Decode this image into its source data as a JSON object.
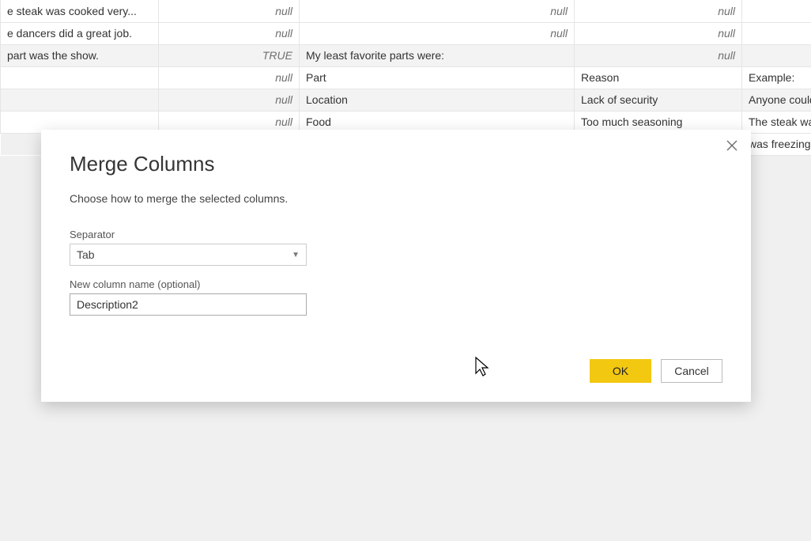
{
  "grid": {
    "rows": [
      {
        "alt": false,
        "c0": "e steak was cooked very...",
        "c1": "null",
        "c2": "null",
        "c3": "null",
        "c4": "null"
      },
      {
        "alt": false,
        "c0": "e dancers did a great job.",
        "c1": "null",
        "c2": "null",
        "c3": "null",
        "c4": "null"
      },
      {
        "alt": true,
        "c0": " part was the show.",
        "c1": "TRUE",
        "c2": "My least favorite parts were:",
        "c3": "null",
        "c4": "null"
      },
      {
        "alt": false,
        "c0": "",
        "c1": "null",
        "c2": "Part",
        "c3": "Reason",
        "c4": "Example:"
      },
      {
        "alt": true,
        "c0": "",
        "c1": "null",
        "c2": "Location",
        "c3": "Lack of security",
        "c4": "Anyone could"
      },
      {
        "alt": false,
        "c0": "",
        "c1": "null",
        "c2": "Food",
        "c3": "Too much seasoning",
        "c4": "The steak wa"
      },
      {
        "alt": true,
        "c0": "",
        "c1": "",
        "c2": "",
        "c3": "",
        "c4": "was freezing"
      }
    ]
  },
  "modal": {
    "title": "Merge Columns",
    "instruction": "Choose how to merge the selected columns.",
    "separator_label": "Separator",
    "separator_value": "Tab",
    "newname_label": "New column name (optional)",
    "newname_value": "Description2",
    "ok": "OK",
    "cancel": "Cancel"
  }
}
